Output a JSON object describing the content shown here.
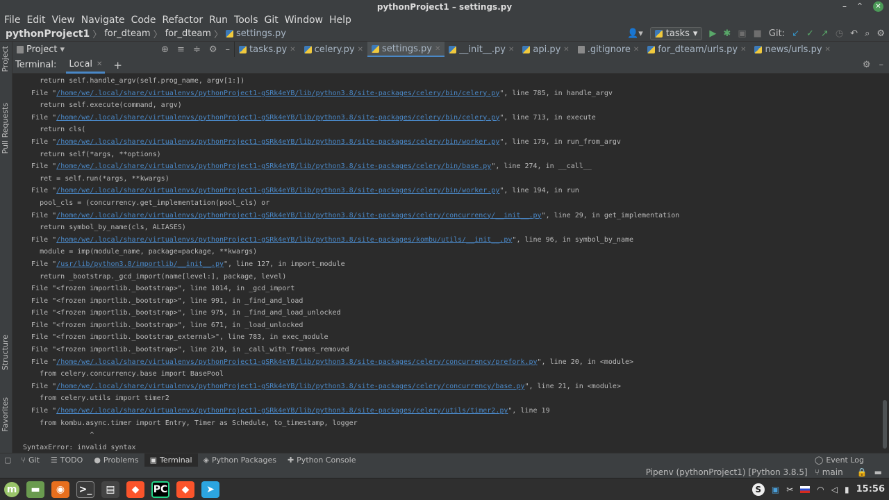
{
  "window": {
    "title": "pythonProject1 – settings.py"
  },
  "menu": [
    "File",
    "Edit",
    "View",
    "Navigate",
    "Code",
    "Refactor",
    "Run",
    "Tools",
    "Git",
    "Window",
    "Help"
  ],
  "navbar": {
    "project": "pythonProject1",
    "crumb1": "for_dteam",
    "crumb2": "for_dteam",
    "file": "settings.py",
    "run_config": "tasks",
    "git_label": "Git:"
  },
  "left_tabs": {
    "project": "Project",
    "pull_requests": "Pull Requests",
    "structure": "Structure",
    "favorites": "Favorites"
  },
  "project_panel": {
    "label": "Project"
  },
  "editor_tabs": [
    {
      "name": "tasks.py",
      "icon": "python-file-icon",
      "active": false
    },
    {
      "name": "celery.py",
      "icon": "python-file-icon",
      "active": false
    },
    {
      "name": "settings.py",
      "icon": "python-file-icon",
      "active": true
    },
    {
      "name": "__init__.py",
      "icon": "python-file-icon",
      "active": false
    },
    {
      "name": "api.py",
      "icon": "python-file-icon",
      "active": false
    },
    {
      "name": ".gitignore",
      "icon": "text-file-icon",
      "active": false
    },
    {
      "name": "for_dteam/urls.py",
      "icon": "python-file-icon",
      "active": false
    },
    {
      "name": "news/urls.py",
      "icon": "python-file-icon",
      "active": false
    }
  ],
  "terminal": {
    "header_label": "Terminal:",
    "tab": "Local",
    "lines": [
      {
        "pre": "    return self.handle_argv(self.prog_name, argv[1:])",
        "link": "",
        "post": ""
      },
      {
        "pre": "  File \"",
        "link": "/home/we/.local/share/virtualenvs/pythonProject1-gSRk4eYB/lib/python3.8/site-packages/celery/bin/celery.py",
        "post": "\", line 785, in handle_argv"
      },
      {
        "pre": "    return self.execute(command, argv)",
        "link": "",
        "post": ""
      },
      {
        "pre": "  File \"",
        "link": "/home/we/.local/share/virtualenvs/pythonProject1-gSRk4eYB/lib/python3.8/site-packages/celery/bin/celery.py",
        "post": "\", line 713, in execute"
      },
      {
        "pre": "    return cls(",
        "link": "",
        "post": ""
      },
      {
        "pre": "  File \"",
        "link": "/home/we/.local/share/virtualenvs/pythonProject1-gSRk4eYB/lib/python3.8/site-packages/celery/bin/worker.py",
        "post": "\", line 179, in run_from_argv"
      },
      {
        "pre": "    return self(*args, **options)",
        "link": "",
        "post": ""
      },
      {
        "pre": "  File \"",
        "link": "/home/we/.local/share/virtualenvs/pythonProject1-gSRk4eYB/lib/python3.8/site-packages/celery/bin/base.py",
        "post": "\", line 274, in __call__"
      },
      {
        "pre": "    ret = self.run(*args, **kwargs)",
        "link": "",
        "post": ""
      },
      {
        "pre": "  File \"",
        "link": "/home/we/.local/share/virtualenvs/pythonProject1-gSRk4eYB/lib/python3.8/site-packages/celery/bin/worker.py",
        "post": "\", line 194, in run"
      },
      {
        "pre": "    pool_cls = (concurrency.get_implementation(pool_cls) or",
        "link": "",
        "post": ""
      },
      {
        "pre": "  File \"",
        "link": "/home/we/.local/share/virtualenvs/pythonProject1-gSRk4eYB/lib/python3.8/site-packages/celery/concurrency/__init__.py",
        "post": "\", line 29, in get_implementation"
      },
      {
        "pre": "    return symbol_by_name(cls, ALIASES)",
        "link": "",
        "post": ""
      },
      {
        "pre": "  File \"",
        "link": "/home/we/.local/share/virtualenvs/pythonProject1-gSRk4eYB/lib/python3.8/site-packages/kombu/utils/__init__.py",
        "post": "\", line 96, in symbol_by_name"
      },
      {
        "pre": "    module = imp(module_name, package=package, **kwargs)",
        "link": "",
        "post": ""
      },
      {
        "pre": "  File \"",
        "link": "/usr/lib/python3.8/importlib/__init__.py",
        "post": "\", line 127, in import_module"
      },
      {
        "pre": "    return _bootstrap._gcd_import(name[level:], package, level)",
        "link": "",
        "post": ""
      },
      {
        "pre": "  File \"<frozen importlib._bootstrap>\", line 1014, in _gcd_import",
        "link": "",
        "post": ""
      },
      {
        "pre": "  File \"<frozen importlib._bootstrap>\", line 991, in _find_and_load",
        "link": "",
        "post": ""
      },
      {
        "pre": "  File \"<frozen importlib._bootstrap>\", line 975, in _find_and_load_unlocked",
        "link": "",
        "post": ""
      },
      {
        "pre": "  File \"<frozen importlib._bootstrap>\", line 671, in _load_unlocked",
        "link": "",
        "post": ""
      },
      {
        "pre": "  File \"<frozen importlib._bootstrap_external>\", line 783, in exec_module",
        "link": "",
        "post": ""
      },
      {
        "pre": "  File \"<frozen importlib._bootstrap>\", line 219, in _call_with_frames_removed",
        "link": "",
        "post": ""
      },
      {
        "pre": "  File \"",
        "link": "/home/we/.local/share/virtualenvs/pythonProject1-gSRk4eYB/lib/python3.8/site-packages/celery/concurrency/prefork.py",
        "post": "\", line 20, in <module>"
      },
      {
        "pre": "    from celery.concurrency.base import BasePool",
        "link": "",
        "post": ""
      },
      {
        "pre": "  File \"",
        "link": "/home/we/.local/share/virtualenvs/pythonProject1-gSRk4eYB/lib/python3.8/site-packages/celery/concurrency/base.py",
        "post": "\", line 21, in <module>"
      },
      {
        "pre": "    from celery.utils import timer2",
        "link": "",
        "post": ""
      },
      {
        "pre": "  File \"",
        "link": "/home/we/.local/share/virtualenvs/pythonProject1-gSRk4eYB/lib/python3.8/site-packages/celery/utils/timer2.py",
        "post": "\", line 19"
      },
      {
        "pre": "    from kombu.async.timer import Entry, Timer as Schedule, to_timestamp, logger",
        "link": "",
        "post": ""
      },
      {
        "pre": "                ^",
        "link": "",
        "post": ""
      },
      {
        "pre": "SyntaxError: invalid syntax",
        "link": "",
        "post": ""
      }
    ]
  },
  "bottom_tabs": [
    {
      "label": "Git",
      "icon": "git-branch-icon"
    },
    {
      "label": "TODO",
      "icon": "list-icon"
    },
    {
      "label": "Problems",
      "icon": "problems-icon"
    },
    {
      "label": "Terminal",
      "icon": "terminal-icon",
      "active": true
    },
    {
      "label": "Python Packages",
      "icon": "packages-icon"
    },
    {
      "label": "Python Console",
      "icon": "python-console-icon"
    }
  ],
  "event_log": "Event Log",
  "status": {
    "interpreter": "Pipenv (pythonProject1) [Python 3.8.5]",
    "branch": "main"
  },
  "taskbar": {
    "clock": "15:56"
  }
}
